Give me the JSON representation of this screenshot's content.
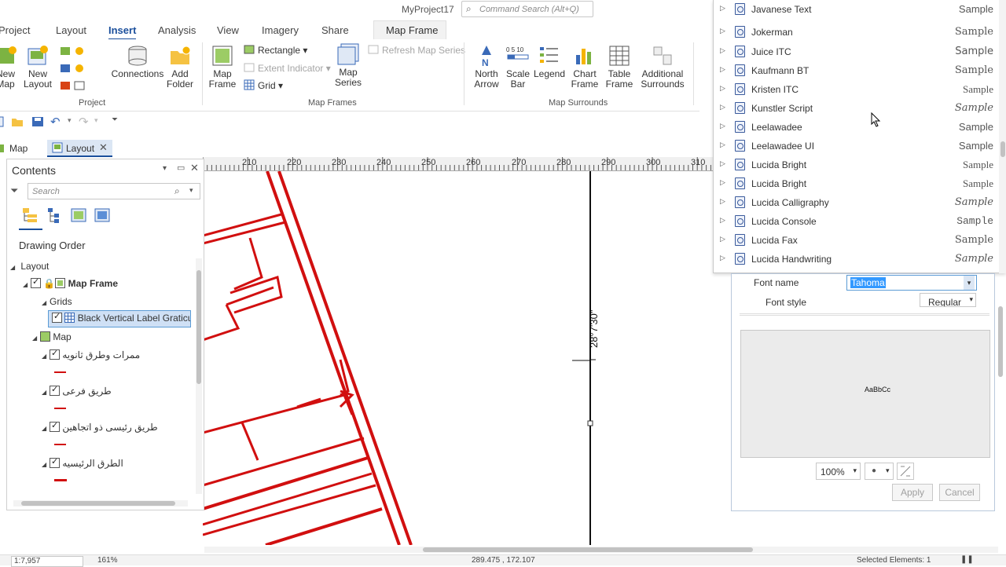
{
  "app": {
    "project_title": "MyProject17"
  },
  "command_search": {
    "placeholder": "Command Search (Alt+Q)"
  },
  "ribbon_tabs": [
    "Project",
    "Layout",
    "Insert",
    "Analysis",
    "View",
    "Imagery",
    "Share"
  ],
  "active_tab": "Insert",
  "contextual_tab": "Map Frame",
  "ribbon": {
    "project_group": {
      "label": "Project",
      "new_map": "New\nMap",
      "new_layout": "New\nLayout",
      "connections": "Connections",
      "add_folder": "Add\nFolder"
    },
    "map_frames_group": {
      "label": "Map Frames",
      "map_frame": "Map\nFrame",
      "rectangle": "Rectangle",
      "extent_indicator": "Extent Indicator",
      "grid": "Grid",
      "refresh_map_series": "Refresh Map Series",
      "map_series": "Map\nSeries"
    },
    "map_surrounds_group": {
      "label": "Map Surrounds",
      "north_arrow": "North\nArrow",
      "scale_bar": "Scale\nBar",
      "legend": "Legend",
      "chart_frame": "Chart\nFrame",
      "table_frame": "Table\nFrame",
      "additional_surrounds": "Additional\nSurrounds"
    }
  },
  "document_tabs": [
    {
      "label": "Map"
    },
    {
      "label": "Layout"
    }
  ],
  "ruler": {
    "labels": [
      "210",
      "220",
      "230",
      "240",
      "250",
      "260",
      "270",
      "280",
      "290",
      "300",
      "310"
    ]
  },
  "contents": {
    "title": "Contents",
    "search_placeholder": "Search",
    "drawing_order_label": "Drawing Order",
    "tree": {
      "layout": "Layout",
      "map_frame": "Map Frame",
      "grids": "Grids",
      "graticule": "Black Vertical Label Graticule",
      "map": "Map",
      "layers": [
        "ممرات وطرق ثانويه",
        "طريق فرعى",
        "طريق رئيسى ذو اتجاهين",
        "الطرق الرئيسيه"
      ]
    }
  },
  "canvas": {
    "graticule_label": "28°7'30\""
  },
  "font_list": {
    "rows": [
      {
        "name": "Javanese Text",
        "sample": "Sample"
      },
      {
        "name": "Jokerman",
        "sample": "Sample"
      },
      {
        "name": "Juice ITC",
        "sample": "Sample"
      },
      {
        "name": "Kaufmann BT",
        "sample": "Sample"
      },
      {
        "name": "Kristen ITC",
        "sample": "Sample"
      },
      {
        "name": "Kunstler Script",
        "sample": "Sample"
      },
      {
        "name": "Leelawadee",
        "sample": "Sample"
      },
      {
        "name": "Leelawadee UI",
        "sample": "Sample"
      },
      {
        "name": "Lucida Bright",
        "sample": "Sample"
      },
      {
        "name": "Lucida Bright",
        "sample": "Sample"
      },
      {
        "name": "Lucida Calligraphy",
        "sample": "Sample"
      },
      {
        "name": "Lucida Console",
        "sample": "Sample"
      },
      {
        "name": "Lucida Fax",
        "sample": "Sample"
      },
      {
        "name": "Lucida Handwriting",
        "sample": "Sample"
      }
    ]
  },
  "font_panel": {
    "font_name_label": "Font name",
    "font_name_value": "Tahoma",
    "font_style_label": "Font style",
    "font_style_value": "Regular",
    "preview_text": "AaBbCc",
    "zoom_value": "100%",
    "apply": "Apply",
    "cancel": "Cancel"
  },
  "status": {
    "scale": "1:7,957",
    "zoom": "161%",
    "coordinates": "289.475 , 172.107",
    "selected": "Selected Elements: 1"
  },
  "colors": {
    "accent": "#1b4f9c",
    "road": "#d10f0f"
  }
}
